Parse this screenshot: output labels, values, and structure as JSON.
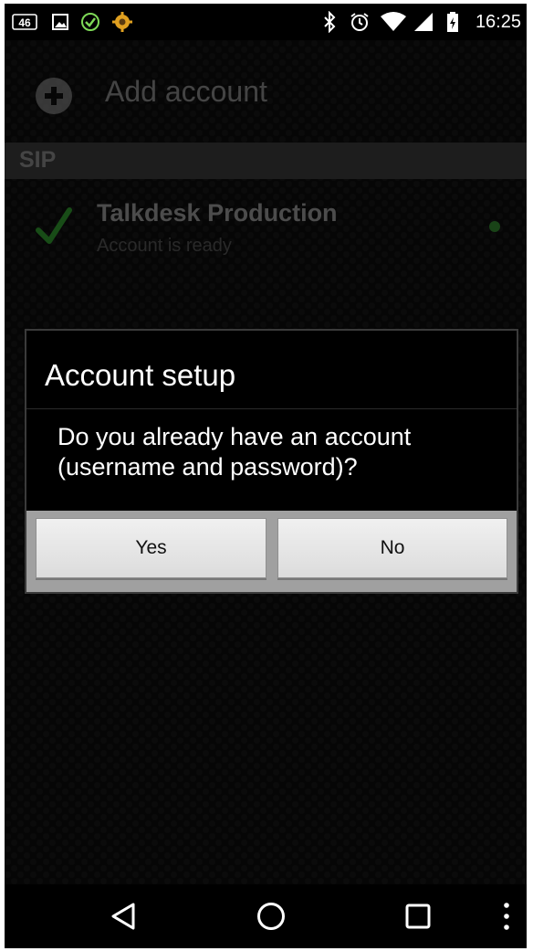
{
  "status_bar": {
    "time": "16:25",
    "left_icons": [
      "lte-46-icon",
      "image-icon",
      "check-circle-icon",
      "settings-gear-icon"
    ],
    "right_icons": [
      "bluetooth-icon",
      "alarm-icon",
      "wifi-icon",
      "cell-signal-icon",
      "battery-icon"
    ]
  },
  "action_bar": {
    "add_label": "Add account"
  },
  "section": {
    "label": "SIP"
  },
  "account": {
    "name": "Talkdesk Production",
    "status": "Account is ready",
    "status_color": "#2f7a2b",
    "check_color": "#2c8a2a"
  },
  "dialog": {
    "title": "Account setup",
    "message": "Do you already have an account (username and password)?",
    "yes_label": "Yes",
    "no_label": "No"
  },
  "nav_bar": {
    "buttons": [
      "back-icon",
      "home-icon",
      "recents-icon",
      "overflow-menu-icon"
    ]
  }
}
